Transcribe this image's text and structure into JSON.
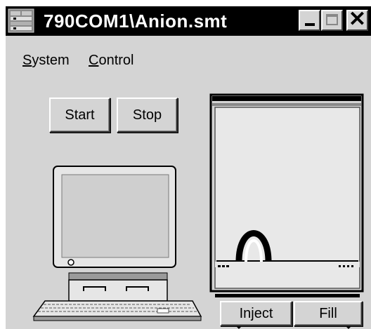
{
  "window": {
    "title": "790COM1\\Anion.smt",
    "app_icon": "instrument-rack-icon",
    "controls": {
      "minimize": "minimize-icon",
      "maximize": "maximize-icon",
      "close_glyph": "✕"
    }
  },
  "menubar": {
    "items": [
      {
        "mnemonic": "S",
        "rest": "ystem"
      },
      {
        "mnemonic": "C",
        "rest": "ontrol"
      }
    ]
  },
  "toolbar": {
    "start_label": "Start",
    "stop_label": "Stop"
  },
  "injector": {
    "inject_label": "Inject",
    "fill_label": "Fill"
  },
  "illustrations": {
    "computer": "computer-icon",
    "instrument": "ion-chromatograph-icon"
  }
}
